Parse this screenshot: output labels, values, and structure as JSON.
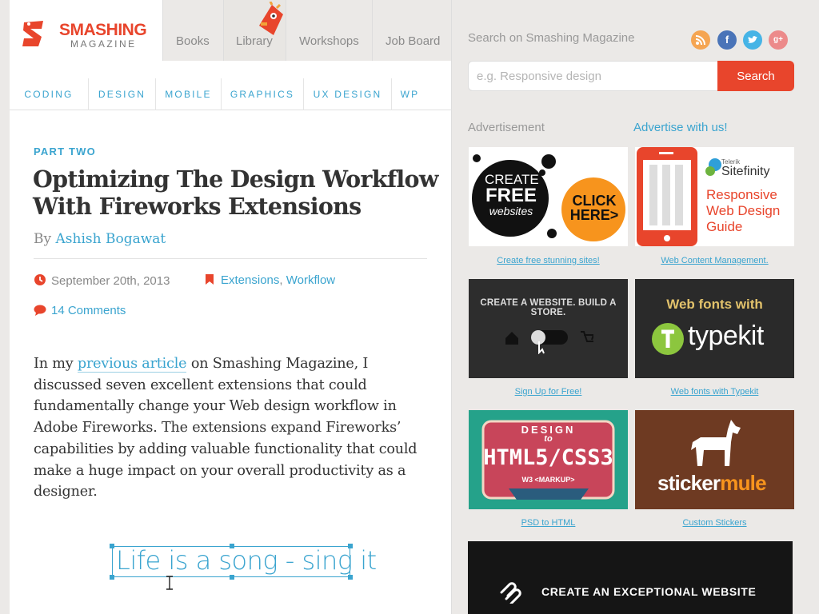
{
  "brand": {
    "name": "SMASHING",
    "sub": "MAGAZINE"
  },
  "topnav": [
    "Books",
    "Library",
    "Workshops",
    "Job Board"
  ],
  "categories": [
    "CODING",
    "DESIGN",
    "MOBILE",
    "GRAPHICS",
    "UX DESIGN",
    "WP"
  ],
  "article": {
    "kicker": "PART TWO",
    "title": "Optimizing The Design Workflow With Fireworks Extensions",
    "by": "By",
    "author": "Ashish Bogawat",
    "date": "September 20th, 2013",
    "tags": [
      "Extensions",
      "Workflow"
    ],
    "tag_sep": ",",
    "comments": "14 Comments",
    "body_pre": "In my",
    "body_link": "previous article",
    "body_post": "on Smashing Magazine, I discussed seven excellent extensions that could fundamentally change your Web design workflow in Adobe Fireworks. The extensions expand Fireworks’ capabilities by adding valuable functionality that could make a huge impact on your overall productivity as a designer.",
    "caption": "Life is a song - sing it"
  },
  "search": {
    "label": "Search on Smashing Magazine",
    "placeholder": "e.g. Responsive design",
    "button": "Search"
  },
  "social_icons": [
    "rss-icon",
    "facebook-icon",
    "twitter-icon",
    "google-plus-icon"
  ],
  "ads": {
    "label": "Advertisement",
    "advertise_link": "Advertise with us!",
    "items": [
      {
        "caption": "Create free stunning sites!",
        "lines": [
          "CREATE",
          "FREE",
          "websites",
          "CLICK",
          "HERE>"
        ]
      },
      {
        "caption": "Web Content Management.",
        "lines": [
          "Telerik",
          "Sitefinity",
          "Responsive",
          "Web Design",
          "Guide"
        ]
      },
      {
        "caption": "Sign Up for Free!",
        "lines": [
          "CREATE A WEBSITE. BUILD A STORE."
        ]
      },
      {
        "caption": "Web fonts with Typekit",
        "lines": [
          "Web fonts with",
          "typekit"
        ]
      },
      {
        "caption": "PSD to HTML",
        "lines": [
          "DESIGN",
          "to",
          "HTML5/CSS3",
          "W3 <MARKUP>"
        ]
      },
      {
        "caption": "Custom Stickers",
        "lines": [
          "sticker",
          "mule"
        ]
      }
    ],
    "bottom": "CREATE AN EXCEPTIONAL WEBSITE"
  },
  "colors": {
    "accent": "#e8452c",
    "link": "#3aa4cf",
    "background": "#ebe9e7"
  }
}
